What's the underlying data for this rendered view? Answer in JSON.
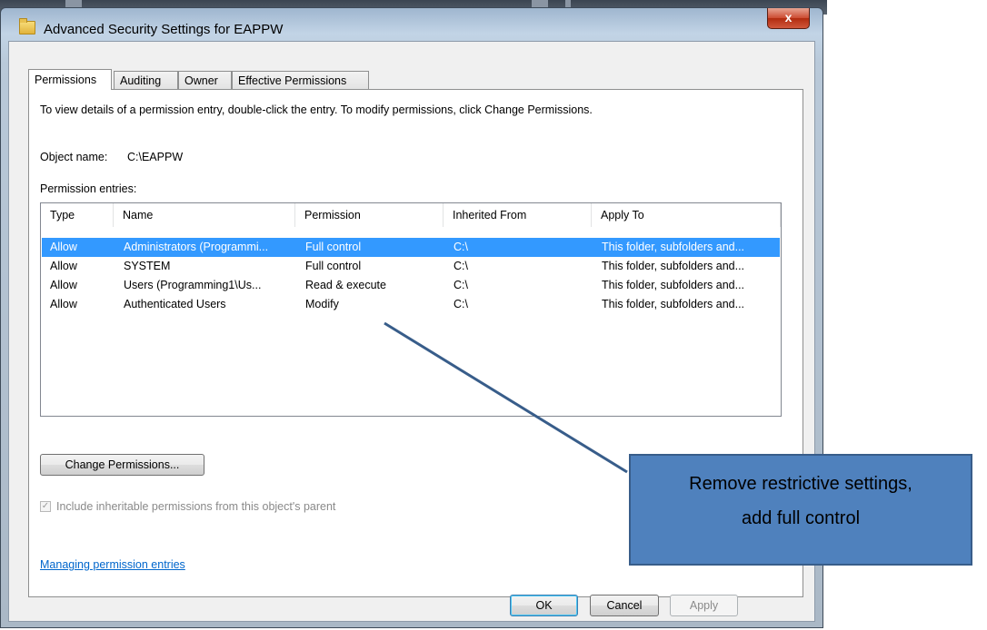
{
  "window": {
    "title": "Advanced Security Settings for EAPPW",
    "close_glyph": "x",
    "title_icon": "folder-icon"
  },
  "tabs": [
    {
      "label": "Permissions",
      "active": true
    },
    {
      "label": "Auditing",
      "active": false
    },
    {
      "label": "Owner",
      "active": false
    },
    {
      "label": "Effective Permissions",
      "active": false
    }
  ],
  "panel": {
    "instructions": "To view details of a permission entry, double-click the entry. To modify permissions, click Change Permissions.",
    "object_name_label": "Object name:",
    "object_name_value": "C:\\EAPPW",
    "entries_label": "Permission entries:"
  },
  "table": {
    "columns": [
      "Type",
      "Name",
      "Permission",
      "Inherited From",
      "Apply To"
    ],
    "rows": [
      {
        "type": "Allow",
        "name": "Administrators (Programmi...",
        "permission": "Full control",
        "inherited": "C:\\",
        "apply": "This folder, subfolders and...",
        "selected": true
      },
      {
        "type": "Allow",
        "name": "SYSTEM",
        "permission": "Full control",
        "inherited": "C:\\",
        "apply": "This folder, subfolders and...",
        "selected": false
      },
      {
        "type": "Allow",
        "name": "Users (Programming1\\Us...",
        "permission": "Read & execute",
        "inherited": "C:\\",
        "apply": "This folder, subfolders and...",
        "selected": false
      },
      {
        "type": "Allow",
        "name": "Authenticated Users",
        "permission": "Modify",
        "inherited": "C:\\",
        "apply": "This folder, subfolders and...",
        "selected": false
      }
    ]
  },
  "change_permissions_label": "Change Permissions...",
  "inherit_checkbox": {
    "label": "Include inheritable permissions from this object's parent",
    "checked": true,
    "disabled": true
  },
  "help_link": "Managing permission entries",
  "footer": {
    "ok": "OK",
    "cancel": "Cancel",
    "apply": "Apply"
  },
  "annotation": {
    "line1": "Remove restrictive settings,",
    "line2": "add full control",
    "color": "#4f81bd"
  },
  "colors": {
    "selection": "#3399ff",
    "link": "#0066cc",
    "close_button": "#c7452a"
  }
}
